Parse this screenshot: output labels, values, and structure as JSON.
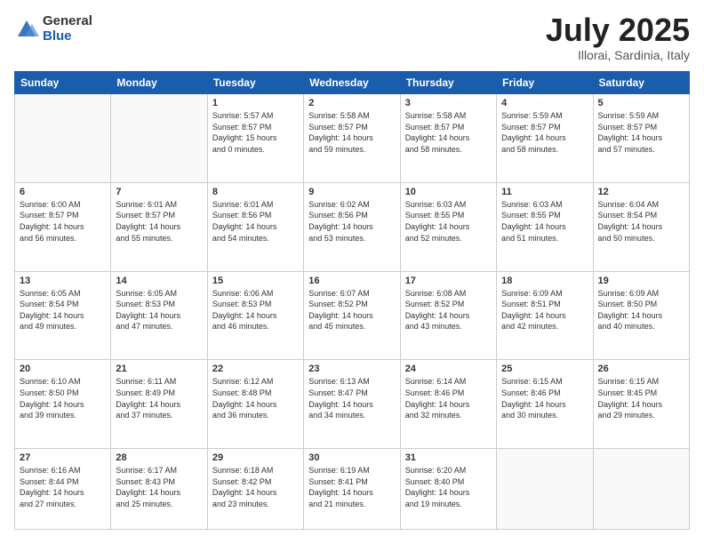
{
  "header": {
    "logo_general": "General",
    "logo_blue": "Blue",
    "title": "July 2025",
    "location": "Illorai, Sardinia, Italy"
  },
  "days_of_week": [
    "Sunday",
    "Monday",
    "Tuesday",
    "Wednesday",
    "Thursday",
    "Friday",
    "Saturday"
  ],
  "weeks": [
    [
      {
        "day": "",
        "content": ""
      },
      {
        "day": "",
        "content": ""
      },
      {
        "day": "1",
        "content": "Sunrise: 5:57 AM\nSunset: 8:57 PM\nDaylight: 15 hours\nand 0 minutes."
      },
      {
        "day": "2",
        "content": "Sunrise: 5:58 AM\nSunset: 8:57 PM\nDaylight: 14 hours\nand 59 minutes."
      },
      {
        "day": "3",
        "content": "Sunrise: 5:58 AM\nSunset: 8:57 PM\nDaylight: 14 hours\nand 58 minutes."
      },
      {
        "day": "4",
        "content": "Sunrise: 5:59 AM\nSunset: 8:57 PM\nDaylight: 14 hours\nand 58 minutes."
      },
      {
        "day": "5",
        "content": "Sunrise: 5:59 AM\nSunset: 8:57 PM\nDaylight: 14 hours\nand 57 minutes."
      }
    ],
    [
      {
        "day": "6",
        "content": "Sunrise: 6:00 AM\nSunset: 8:57 PM\nDaylight: 14 hours\nand 56 minutes."
      },
      {
        "day": "7",
        "content": "Sunrise: 6:01 AM\nSunset: 8:57 PM\nDaylight: 14 hours\nand 55 minutes."
      },
      {
        "day": "8",
        "content": "Sunrise: 6:01 AM\nSunset: 8:56 PM\nDaylight: 14 hours\nand 54 minutes."
      },
      {
        "day": "9",
        "content": "Sunrise: 6:02 AM\nSunset: 8:56 PM\nDaylight: 14 hours\nand 53 minutes."
      },
      {
        "day": "10",
        "content": "Sunrise: 6:03 AM\nSunset: 8:55 PM\nDaylight: 14 hours\nand 52 minutes."
      },
      {
        "day": "11",
        "content": "Sunrise: 6:03 AM\nSunset: 8:55 PM\nDaylight: 14 hours\nand 51 minutes."
      },
      {
        "day": "12",
        "content": "Sunrise: 6:04 AM\nSunset: 8:54 PM\nDaylight: 14 hours\nand 50 minutes."
      }
    ],
    [
      {
        "day": "13",
        "content": "Sunrise: 6:05 AM\nSunset: 8:54 PM\nDaylight: 14 hours\nand 49 minutes."
      },
      {
        "day": "14",
        "content": "Sunrise: 6:05 AM\nSunset: 8:53 PM\nDaylight: 14 hours\nand 47 minutes."
      },
      {
        "day": "15",
        "content": "Sunrise: 6:06 AM\nSunset: 8:53 PM\nDaylight: 14 hours\nand 46 minutes."
      },
      {
        "day": "16",
        "content": "Sunrise: 6:07 AM\nSunset: 8:52 PM\nDaylight: 14 hours\nand 45 minutes."
      },
      {
        "day": "17",
        "content": "Sunrise: 6:08 AM\nSunset: 8:52 PM\nDaylight: 14 hours\nand 43 minutes."
      },
      {
        "day": "18",
        "content": "Sunrise: 6:09 AM\nSunset: 8:51 PM\nDaylight: 14 hours\nand 42 minutes."
      },
      {
        "day": "19",
        "content": "Sunrise: 6:09 AM\nSunset: 8:50 PM\nDaylight: 14 hours\nand 40 minutes."
      }
    ],
    [
      {
        "day": "20",
        "content": "Sunrise: 6:10 AM\nSunset: 8:50 PM\nDaylight: 14 hours\nand 39 minutes."
      },
      {
        "day": "21",
        "content": "Sunrise: 6:11 AM\nSunset: 8:49 PM\nDaylight: 14 hours\nand 37 minutes."
      },
      {
        "day": "22",
        "content": "Sunrise: 6:12 AM\nSunset: 8:48 PM\nDaylight: 14 hours\nand 36 minutes."
      },
      {
        "day": "23",
        "content": "Sunrise: 6:13 AM\nSunset: 8:47 PM\nDaylight: 14 hours\nand 34 minutes."
      },
      {
        "day": "24",
        "content": "Sunrise: 6:14 AM\nSunset: 8:46 PM\nDaylight: 14 hours\nand 32 minutes."
      },
      {
        "day": "25",
        "content": "Sunrise: 6:15 AM\nSunset: 8:46 PM\nDaylight: 14 hours\nand 30 minutes."
      },
      {
        "day": "26",
        "content": "Sunrise: 6:15 AM\nSunset: 8:45 PM\nDaylight: 14 hours\nand 29 minutes."
      }
    ],
    [
      {
        "day": "27",
        "content": "Sunrise: 6:16 AM\nSunset: 8:44 PM\nDaylight: 14 hours\nand 27 minutes."
      },
      {
        "day": "28",
        "content": "Sunrise: 6:17 AM\nSunset: 8:43 PM\nDaylight: 14 hours\nand 25 minutes."
      },
      {
        "day": "29",
        "content": "Sunrise: 6:18 AM\nSunset: 8:42 PM\nDaylight: 14 hours\nand 23 minutes."
      },
      {
        "day": "30",
        "content": "Sunrise: 6:19 AM\nSunset: 8:41 PM\nDaylight: 14 hours\nand 21 minutes."
      },
      {
        "day": "31",
        "content": "Sunrise: 6:20 AM\nSunset: 8:40 PM\nDaylight: 14 hours\nand 19 minutes."
      },
      {
        "day": "",
        "content": ""
      },
      {
        "day": "",
        "content": ""
      }
    ]
  ]
}
